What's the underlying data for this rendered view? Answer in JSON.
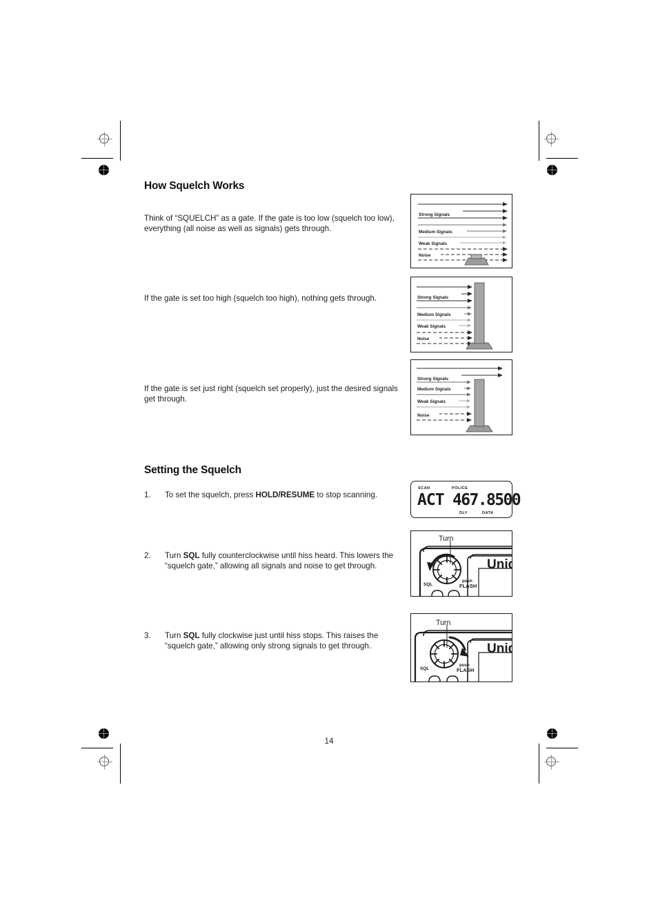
{
  "document": {
    "page_number": "14",
    "sections": [
      {
        "id": "how-squelch-works",
        "heading": "How Squelch Works"
      },
      {
        "id": "setting-the-squelch",
        "heading": "Setting the Squelch"
      }
    ],
    "paragraphs": {
      "p1_part1": "Think of “SQUELCH” as a gate. If the gate is too low (squelch too low), everything (all noise as well as signals) gets through.",
      "p2": "If the gate is set too high (squelch too high), nothing gets through.",
      "p3": "If the gate is set just right (squelch set properly), just the desired signals get through."
    },
    "steps": [
      {
        "number": "1.",
        "text_before": "To set the squelch, press ",
        "bold": "HOLD/RESUME",
        "text_after": " to stop scanning."
      },
      {
        "number": "2.",
        "text_before": "Turn ",
        "bold": "SQL",
        "text_after": " fully counterclockwise until hiss heard. This lowers the “squelch gate,” allowing all signals and noise to get through."
      },
      {
        "number": "3.",
        "text_before": "Turn ",
        "bold": "SQL",
        "text_after": " fully clockwise just until hiss stops. This raises the “squelch gate,” allowing only strong signals to get through."
      }
    ]
  },
  "figures": {
    "gate_labels": {
      "strong": "Strong Signals",
      "medium": "Medium Signals",
      "weak": "Weak Signals",
      "noise": "Noise"
    },
    "gate_diagrams": [
      {
        "id": "gate-low",
        "caption_state": "gate too low",
        "gate_height_pct": 12
      },
      {
        "id": "gate-high",
        "caption_state": "gate too high",
        "gate_height_pct": 100
      },
      {
        "id": "gate-right",
        "caption_state": "gate just right",
        "gate_height_pct": 72
      }
    ],
    "lcd": {
      "scan_label": "SCAN",
      "police_label": "POLICE",
      "mode": "ACT",
      "frequency": "467.8500",
      "dly_label": "DLY",
      "data_label": "DATA"
    },
    "knob_panels": [
      {
        "id": "knob-ccw",
        "turn_label": "Turn",
        "sql_label": "SQL",
        "push_label": "push",
        "flash_label": "FLASH",
        "brand_label": "Unid",
        "direction": "counterclockwise"
      },
      {
        "id": "knob-cw",
        "turn_label": "Turn",
        "sql_label": "SQL",
        "push_label": "push",
        "flash_label": "FLASH",
        "brand_label": "Unid",
        "direction": "clockwise"
      }
    ]
  },
  "colors": {
    "ink": "#1b1b1b",
    "paper": "#ffffff",
    "gate_fill": "#9b9b9b",
    "signal_strong": "#2a2a2a",
    "signal_medium": "#6e6e6e",
    "signal_weak": "#a8a8a8"
  }
}
